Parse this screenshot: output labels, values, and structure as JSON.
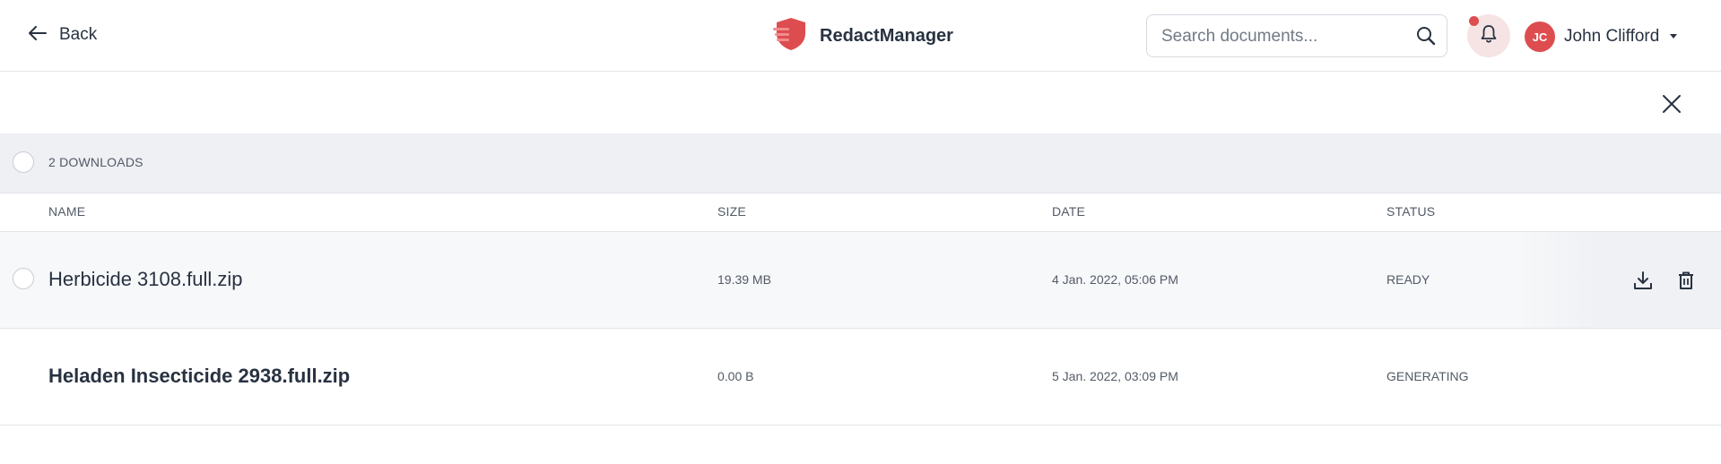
{
  "header": {
    "back_label": "Back",
    "brand_name": "RedactManager",
    "search_placeholder": "Search documents...",
    "user": {
      "initials": "JC",
      "name": "John Clifford"
    }
  },
  "downloads": {
    "count_label": "2 DOWNLOADS",
    "columns": {
      "name": "NAME",
      "size": "SIZE",
      "date": "DATE",
      "status": "STATUS"
    },
    "rows": [
      {
        "name": "Herbicide 3108.full.zip",
        "size": "19.39 MB",
        "date": "4 Jan. 2022, 05:06 PM",
        "status": "READY"
      },
      {
        "name": "Heladen Insecticide 2938.full.zip",
        "size": "0.00 B",
        "date": "5 Jan. 2022, 03:09 PM",
        "status": "GENERATING"
      }
    ]
  },
  "colors": {
    "accent": "#dd4d50",
    "text": "#283241",
    "muted": "#525a66",
    "bar_bg": "#eef0f4"
  },
  "icons": [
    "arrow-left-icon",
    "logo-icon",
    "search-icon",
    "bell-icon",
    "caret-down-icon",
    "close-icon",
    "download-icon",
    "trash-icon"
  ]
}
